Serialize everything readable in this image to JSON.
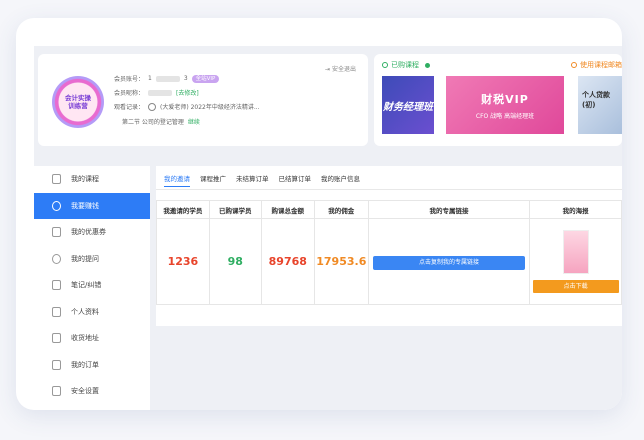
{
  "profile": {
    "avatar_line1": "会计实操",
    "avatar_line2": "训练营",
    "account_label": "会员账号：",
    "account_value": "1",
    "account_suffix": "3",
    "vip_badge": "全站VIP",
    "nickname_label": "会员昵称：",
    "nickname_tag": "[去修改]",
    "record_label": "观看记录：",
    "record_value": "(大爱老师) 2022年中级经济法精讲...",
    "record_sub": "第二节 公司的登记管理",
    "record_continue": "继续",
    "logout": "安全退出"
  },
  "courses": {
    "title": "已购课程",
    "right_title": "使用课程邮箱",
    "img1_text": "财务经理班",
    "img2_big": "财税VIP",
    "img2_small": "CFO 战略   高端经理班",
    "img3_text": "个人贷款(初)"
  },
  "sidebar": {
    "items": [
      {
        "label": "我的课程"
      },
      {
        "label": "我要赚钱"
      },
      {
        "label": "我的优惠券"
      },
      {
        "label": "我的提问"
      },
      {
        "label": "笔记/纠错"
      },
      {
        "label": "个人资料"
      },
      {
        "label": "收货地址"
      },
      {
        "label": "我的订单"
      },
      {
        "label": "安全设置"
      }
    ]
  },
  "tabs": [
    {
      "label": "我的邀请"
    },
    {
      "label": "课程推广"
    },
    {
      "label": "未结算订单"
    },
    {
      "label": "已结算订单"
    },
    {
      "label": "我的账户信息"
    }
  ],
  "table": {
    "headers": [
      "我邀请的学员",
      "已购课学员",
      "购课总金额",
      "我的佣金",
      "我的专属链接",
      "我的海报"
    ],
    "invited": "1236",
    "purchased": "98",
    "total": "89768",
    "commission": "17953.6",
    "link_button": "点击复制我的专属链接",
    "download_button": "点击下载"
  },
  "colors": {
    "accent": "#2d7cf6",
    "green": "#2fae62",
    "red": "#e8442b",
    "orange": "#f08a24"
  }
}
